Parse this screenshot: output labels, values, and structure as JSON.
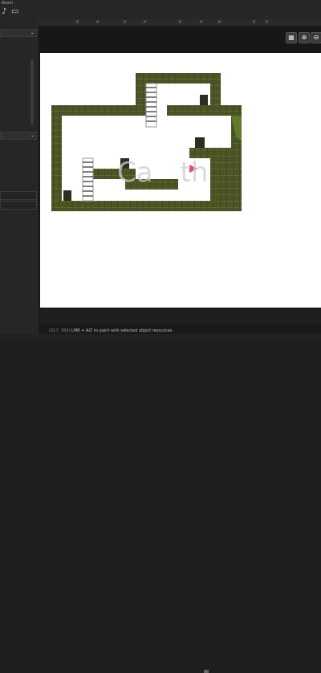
{
  "window": {
    "title": "Room"
  },
  "toolbar": {
    "icons": [
      "music-icon",
      "display-icon"
    ]
  },
  "tabs": {
    "close_glyph": "×"
  },
  "canvas": {
    "zoom_buttons": [
      "grid-toggle-icon",
      "zoom-in-icon",
      "zoom-out-icon"
    ],
    "watermark_text": "Ca th",
    "colors": {
      "background": "#ffffff",
      "ground": "#4e5326",
      "ground_edge": "#5e7a2e",
      "door": "#2f2c21",
      "spikes": "#e0447c"
    }
  },
  "status": {
    "coordinates": "(517, 783)",
    "hint": "LMB + ALT to paint with selected object resources."
  }
}
